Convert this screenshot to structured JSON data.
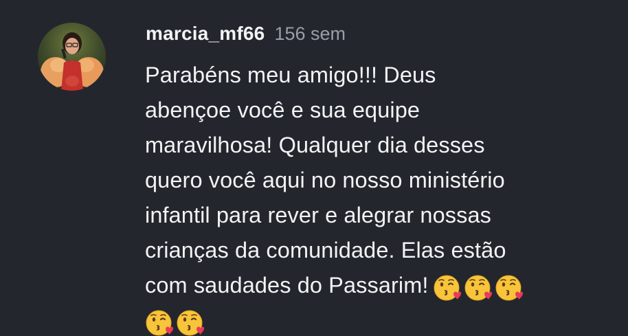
{
  "comment": {
    "username": "marcia_mf66",
    "timestamp": "156 sem",
    "text_lines": [
      "Parabéns meu amigo!!! Deus",
      "abençoe você e sua equipe",
      "maravilhosa! Qualquer dia desses",
      "quero você aqui no nosso ministério",
      "infantil para rever e alegrar nossas",
      "crianças da comunidade. Elas estão",
      "com saudades do Passarim!"
    ],
    "emoji_name": "face-blowing-a-kiss-emoji",
    "emoji_count_line7": 3,
    "emoji_count_line8": 2
  },
  "colors": {
    "background": "#24262d",
    "primary_text": "#f2f3f5",
    "secondary_text": "#9a9ea7"
  }
}
